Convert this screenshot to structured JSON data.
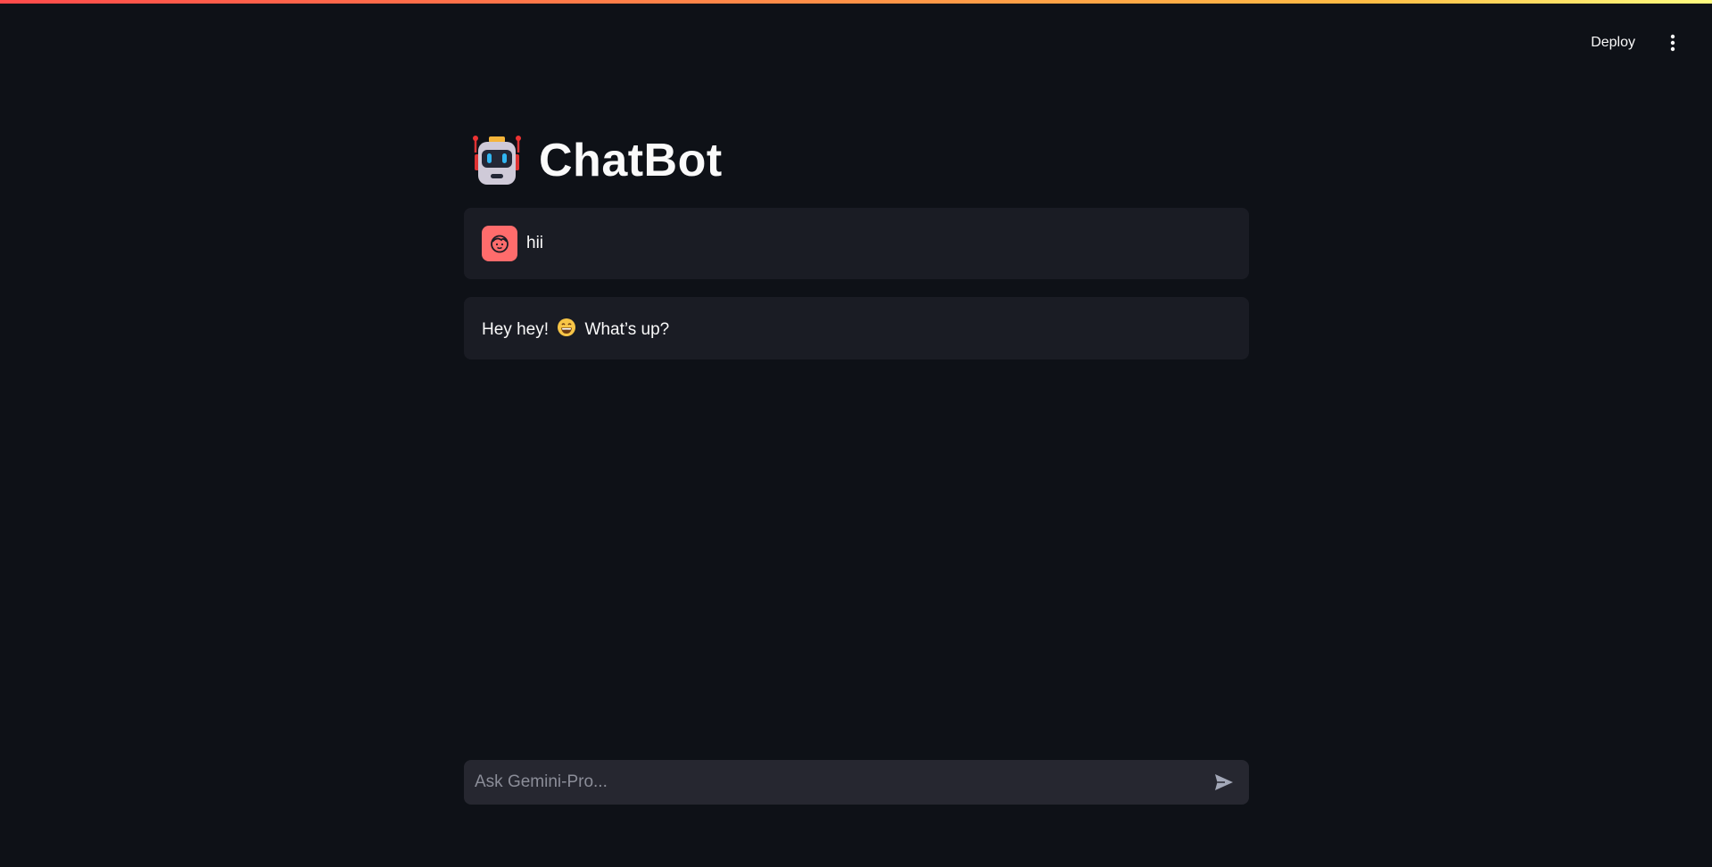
{
  "header": {
    "deploy_label": "Deploy",
    "menu_icon": "kebab-menu-icon"
  },
  "main": {
    "title": "ChatBot",
    "title_icon": "robot-icon"
  },
  "messages": [
    {
      "role": "user",
      "avatar_icon": "user-face-icon",
      "text": "hii"
    },
    {
      "role": "assistant",
      "text_before": "Hey hey!",
      "emoji_icon": "grinning-face-icon",
      "text_after": "What’s up?"
    }
  ],
  "chat_input": {
    "placeholder": "Ask Gemini-Pro...",
    "value": "",
    "send_icon": "send-icon"
  },
  "colors": {
    "background": "#0e1117",
    "message_bg": "#1a1c24",
    "input_bg": "#262730",
    "avatar": "#ff6c6c",
    "accent_gradient_start": "#ff4b4b",
    "accent_gradient_end": "#fffd80"
  }
}
